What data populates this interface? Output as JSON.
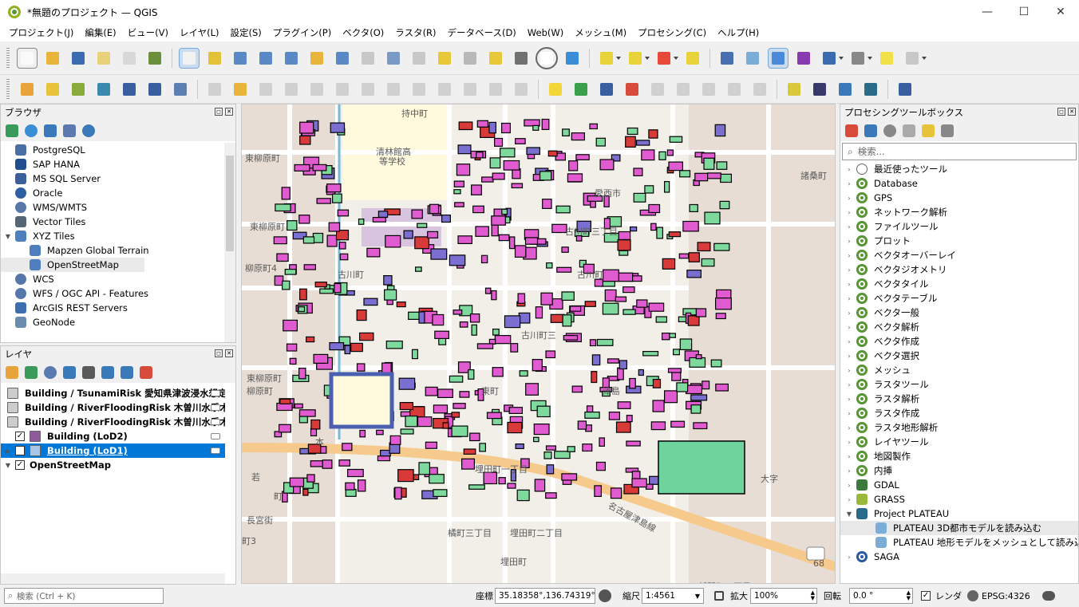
{
  "window": {
    "title": "*無題のプロジェクト — QGIS"
  },
  "menu": [
    "プロジェクト(J)",
    "編集(E)",
    "ビュー(V)",
    "レイヤ(L)",
    "設定(S)",
    "プラグイン(P)",
    "ベクタ(O)",
    "ラスタ(R)",
    "データベース(D)",
    "Web(W)",
    "メッシュ(M)",
    "プロセシング(C)",
    "ヘルプ(H)"
  ],
  "browser": {
    "title": "ブラウザ",
    "items": [
      {
        "label": "PostgreSQL",
        "icon": "elephant-icon",
        "color": "#4a6fa5"
      },
      {
        "label": "SAP HANA",
        "icon": "hana-icon",
        "color": "#1f4f8f"
      },
      {
        "label": "MS SQL Server",
        "icon": "mssql-icon",
        "color": "#3a5f9a"
      },
      {
        "label": "Oracle",
        "icon": "oracle-icon",
        "color": "#2f5fa3"
      },
      {
        "label": "WMS/WMTS",
        "icon": "globe-icon",
        "color": "#5577aa"
      },
      {
        "label": "Vector Tiles",
        "icon": "grid-icon",
        "color": "#556677"
      },
      {
        "label": "XYZ Tiles",
        "icon": "xyz-grid-icon",
        "color": "#4f7fbf"
      },
      {
        "label": "Mapzen Global Terrain",
        "icon": "xyz-grid-icon",
        "color": "#4f7fbf"
      },
      {
        "label": "OpenStreetMap",
        "icon": "xyz-grid-icon",
        "color": "#4f7fbf"
      },
      {
        "label": "WCS",
        "icon": "globe-icon",
        "color": "#5577aa"
      },
      {
        "label": "WFS / OGC API - Features",
        "icon": "globe-icon",
        "color": "#5577aa"
      },
      {
        "label": "ArcGIS REST Servers",
        "icon": "arcgis-icon",
        "color": "#3b6fb0"
      },
      {
        "label": "GeoNode",
        "icon": "geonode-icon",
        "color": "#6a8caf"
      }
    ]
  },
  "layers": {
    "title": "レイヤ",
    "items": [
      {
        "label": "Building / TsunamiRisk 愛知県津波浸水想定",
        "checked": false,
        "color": "#cccccc"
      },
      {
        "label": "Building / RiverFloodingRisk 木曽川水系木曽",
        "checked": false,
        "color": "#cccccc"
      },
      {
        "label": "Building / RiverFloodingRisk 木曽川水系木曽",
        "checked": false,
        "color": "#cccccc"
      },
      {
        "label": "Building (LoD2)",
        "checked": true,
        "color": "#8e5a9b"
      },
      {
        "label": "Building (LoD1)",
        "checked": true,
        "color": "#a7c6e8"
      },
      {
        "label": "OpenStreetMap",
        "checked": true,
        "color": "#ffffff"
      }
    ]
  },
  "processing": {
    "title": "プロセシングツールボックス",
    "search_placeholder": "検索...",
    "items": [
      {
        "label": "最近使ったツール",
        "icon": "clock-icon",
        "expanded": false
      },
      {
        "label": "Database",
        "icon": "qgis-icon",
        "expanded": false
      },
      {
        "label": "GPS",
        "icon": "qgis-icon",
        "expanded": false
      },
      {
        "label": "ネットワーク解析",
        "icon": "qgis-icon",
        "expanded": false
      },
      {
        "label": "ファイルツール",
        "icon": "qgis-icon",
        "expanded": false
      },
      {
        "label": "プロット",
        "icon": "qgis-icon",
        "expanded": false
      },
      {
        "label": "ベクタオーバーレイ",
        "icon": "qgis-icon",
        "expanded": false
      },
      {
        "label": "ベクタジオメトリ",
        "icon": "qgis-icon",
        "expanded": false
      },
      {
        "label": "ベクタタイル",
        "icon": "qgis-icon",
        "expanded": false
      },
      {
        "label": "ベクタテーブル",
        "icon": "qgis-icon",
        "expanded": false
      },
      {
        "label": "ベクタ一般",
        "icon": "qgis-icon",
        "expanded": false
      },
      {
        "label": "ベクタ解析",
        "icon": "qgis-icon",
        "expanded": false
      },
      {
        "label": "ベクタ作成",
        "icon": "qgis-icon",
        "expanded": false
      },
      {
        "label": "ベクタ選択",
        "icon": "qgis-icon",
        "expanded": false
      },
      {
        "label": "メッシュ",
        "icon": "qgis-icon",
        "expanded": false
      },
      {
        "label": "ラスタツール",
        "icon": "qgis-icon",
        "expanded": false
      },
      {
        "label": "ラスタ解析",
        "icon": "qgis-icon",
        "expanded": false
      },
      {
        "label": "ラスタ作成",
        "icon": "qgis-icon",
        "expanded": false
      },
      {
        "label": "ラスタ地形解析",
        "icon": "qgis-icon",
        "expanded": false
      },
      {
        "label": "レイヤツール",
        "icon": "qgis-icon",
        "expanded": false
      },
      {
        "label": "地図製作",
        "icon": "qgis-icon",
        "expanded": false
      },
      {
        "label": "内挿",
        "icon": "qgis-icon",
        "expanded": false
      },
      {
        "label": "GDAL",
        "icon": "gdal-icon",
        "expanded": false
      },
      {
        "label": "GRASS",
        "icon": "grass-icon",
        "expanded": false
      },
      {
        "label": "Project PLATEAU",
        "icon": "plateau-icon",
        "expanded": true
      },
      {
        "label": "PLATEAU 3D都市モデルを読み込む",
        "icon": "gear-icon",
        "child": true
      },
      {
        "label": "PLATEAU 地形モデルをメッシュとして読み込む",
        "icon": "gear-icon",
        "child": true
      },
      {
        "label": "SAGA",
        "icon": "saga-icon",
        "expanded": false
      }
    ]
  },
  "map": {
    "labels": [
      "持中町",
      "清林館高",
      "等学校",
      "東柳原町",
      "諸桑町",
      "愛西市",
      "古川町三丁目",
      "東柳原町",
      "柳原町4",
      "古川町",
      "古川町",
      "古川町三",
      "東柳原町",
      "柳原町",
      "埋田町一丁目",
      "津島",
      "東町",
      "本",
      "若",
      "長宮街",
      "橘町三丁目",
      "埋田町二丁目",
      "埋田町",
      "新開町一丁目",
      "名古屋津島線",
      "大字",
      "68",
      "町3",
      "町"
    ]
  },
  "status": {
    "search_placeholder": "検索 (Ctrl + K)",
    "coord_label": "座標",
    "coord_value": "35.18358°,136.74319°",
    "scale_label": "縮尺",
    "scale_value": "1:4561",
    "zoom_label": "拡大",
    "zoom_value": "100%",
    "rotation_label": "回転",
    "rotation_value": "0.0 °",
    "render_label": "レンダ",
    "crs": "EPSG:4326"
  }
}
